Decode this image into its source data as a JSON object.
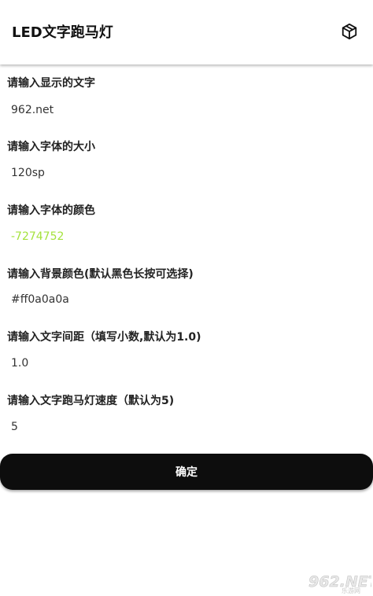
{
  "app": {
    "title": "LED文字跑马灯",
    "action_icon": "cube-icon"
  },
  "fields": [
    {
      "label": "请输入显示的文字",
      "value": "962.net"
    },
    {
      "label": "请输入字体的大小",
      "value": "120sp"
    },
    {
      "label": "请输入字体的颜色",
      "value": "-7274752",
      "color": "#a4e23c"
    },
    {
      "label": "请输入背景颜色(默认黑色长按可选择)",
      "value": "#ff0a0a0a"
    },
    {
      "label": "请输入文字间距（填写小数,默认为1.0)",
      "value": "1.0"
    },
    {
      "label": "请输入文字跑马灯速度（默认为5)",
      "value": "5"
    }
  ],
  "confirm_label": "确定",
  "watermark": {
    "logo_text": "962.NET",
    "sub_text": "乐游网"
  }
}
